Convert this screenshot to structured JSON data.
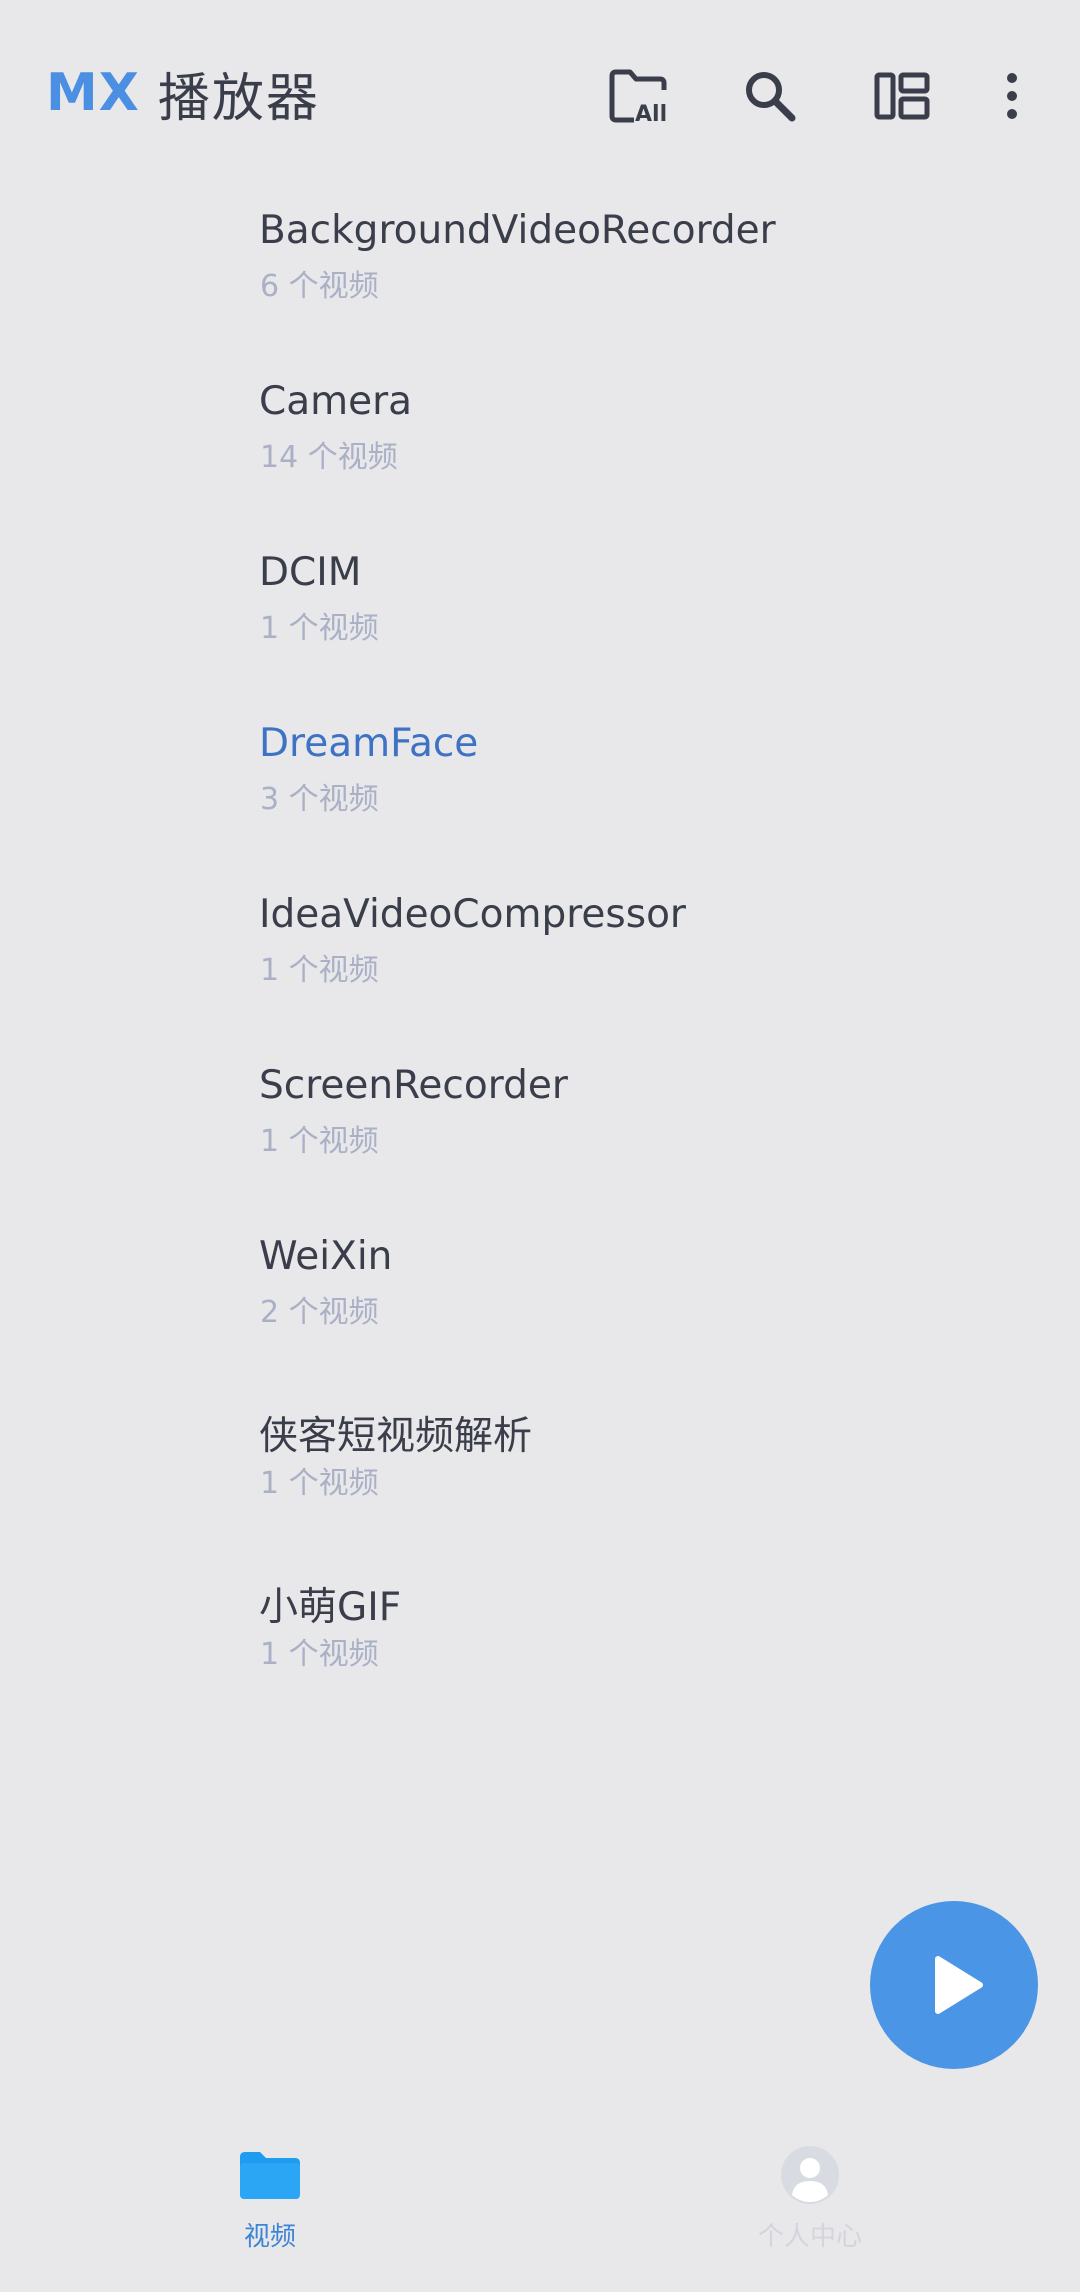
{
  "appbar": {
    "brand_mx": "MX",
    "brand_name": "播放器",
    "icons": [
      "folder-all-icon",
      "search-icon",
      "layout-icon",
      "more-vert-icon"
    ],
    "folder_all_badge": "All"
  },
  "folders": [
    {
      "name": "BackgroundVideoRecorder",
      "count": "6 个视频"
    },
    {
      "name": "Camera",
      "count": "14 个视频"
    },
    {
      "name": "DCIM",
      "count": "1 个视频"
    },
    {
      "name": "DreamFace",
      "count": "3 个视频"
    },
    {
      "name": "IdeaVideoCompressor",
      "count": "1 个视频"
    },
    {
      "name": "ScreenRecorder",
      "count": "1 个视频"
    },
    {
      "name": "WeiXin",
      "count": "2 个视频"
    },
    {
      "name": "侠客短视频解析",
      "count": "1 个视频"
    },
    {
      "name": "小萌GIF",
      "count": "1 个视频"
    }
  ],
  "active_folder": "DreamFace",
  "fab": {
    "icon": "play-icon"
  },
  "bottom_nav": {
    "videos_label": "视频",
    "profile_label": "个人中心"
  },
  "colors": {
    "accent": "#4a8fe2",
    "active_text": "#3e72c4",
    "background": "#e8e8ea",
    "fab": "#4a95e6",
    "nav_folder": "#1e9cf0"
  }
}
